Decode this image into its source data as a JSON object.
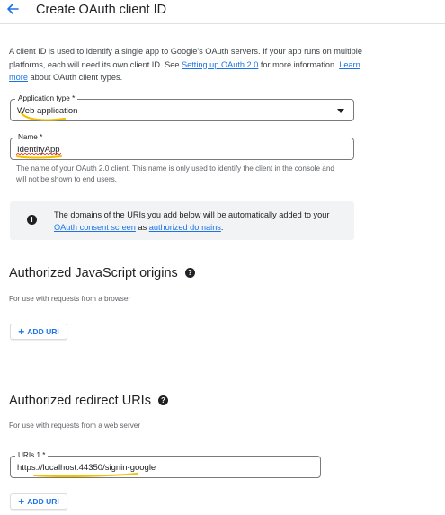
{
  "header": {
    "title": "Create OAuth client ID"
  },
  "intro": {
    "text_1": "A client ID is used to identify a single app to Google's OAuth servers. If your app runs on multiple platforms, each will need its own client ID. See ",
    "link_1": "Setting up OAuth 2.0",
    "text_2": " for more information. ",
    "link_2": "Learn more",
    "text_3": " about OAuth client types."
  },
  "application_type": {
    "label": "Application type *",
    "value": "Web application"
  },
  "name_field": {
    "label": "Name *",
    "value": "IdentityApp",
    "hint": "The name of your OAuth 2.0 client. This name is only used to identify the client in the console and will not be shown to end users."
  },
  "info_box": {
    "text_1": "The domains of the URIs you add below will be automatically added to your ",
    "link_1": "OAuth consent screen",
    "text_2": " as ",
    "link_2": "authorized domains",
    "text_3": "."
  },
  "js_origins": {
    "title": "Authorized JavaScript origins",
    "subtitle": "For use with requests from a browser",
    "add_label": "ADD URI"
  },
  "redirect_uris": {
    "title": "Authorized redirect URIs",
    "subtitle": "For use with requests from a web server",
    "uri_label": "URIs 1 *",
    "uri_value": "https://localhost:44350/signin-google",
    "add_label": "ADD URI"
  },
  "icons": {
    "back": "arrow-back-icon",
    "info": "info-icon",
    "help": "help-icon",
    "dropdown": "dropdown-arrow-icon",
    "add": "plus-icon"
  },
  "colors": {
    "accent": "#1a73e8",
    "highlight": "#f2c200",
    "spellcheck": "#d93025"
  }
}
